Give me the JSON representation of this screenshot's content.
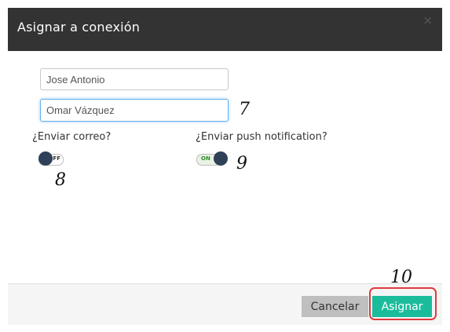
{
  "modal": {
    "title": "Asignar a conexión",
    "close_glyph": "×"
  },
  "form": {
    "from_value": "Jose Antonio",
    "to_value": "Omar Vázquez",
    "email_label": "¿Enviar correo?",
    "email_toggle_text": "OFF",
    "push_label": "¿Enviar push notification?",
    "push_toggle_text": "ON"
  },
  "annotations": {
    "a7": "7",
    "a8": "8",
    "a9": "9",
    "a10": "10"
  },
  "footer": {
    "cancel_label": "Cancelar",
    "assign_label": "Asignar"
  },
  "colors": {
    "header_bg": "#333333",
    "assign_button": "#1bbc9b",
    "cancel_button": "#bfbfbf",
    "toggle_knob": "#2f4058",
    "highlight_ring": "#e0393e"
  }
}
